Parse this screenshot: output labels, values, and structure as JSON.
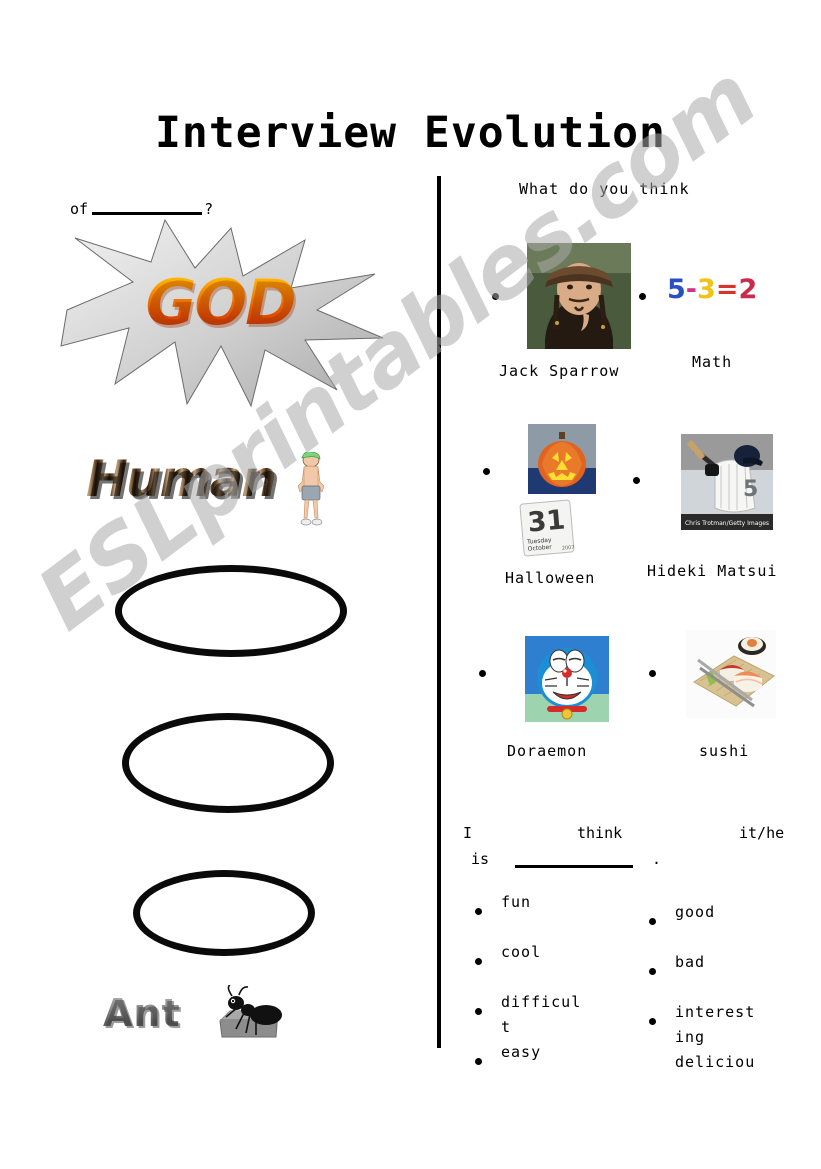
{
  "page": {
    "title": "Interview Evolution"
  },
  "left": {
    "of_prefix": "of",
    "of_suffix": "?",
    "god_word": "GOD",
    "human_word": "Human",
    "ant_word": "Ant",
    "human_figure_icon": "cartoon-muscle-man-icon",
    "ant_figure_icon": "ant-on-rock-icon",
    "starburst_icon": "starburst-shape-icon",
    "ovals": [
      {
        "name": "oval-1"
      },
      {
        "name": "oval-2"
      },
      {
        "name": "oval-3"
      }
    ]
  },
  "right": {
    "heading": "What do you think",
    "items": [
      {
        "label": "Jack Sparrow",
        "icon": "jack-sparrow-photo"
      },
      {
        "label": "Math",
        "icon": "math-equation-image"
      },
      {
        "label": "Halloween",
        "icon": "jack-o-lantern-photo"
      },
      {
        "label": "Hideki Matsui",
        "icon": "baseball-player-photo"
      },
      {
        "label": "Doraemon",
        "icon": "doraemon-cartoon-image"
      },
      {
        "label": "sushi",
        "icon": "sushi-platter-photo"
      }
    ],
    "math": {
      "five": "5",
      "minus": "-",
      "three": "3",
      "equals": "=",
      "two": "2"
    },
    "calendar": {
      "day_number": "31",
      "weekday": "Tuesday",
      "month": "October"
    },
    "baseball_photo_credit": "Chris Trotman/Getty Images",
    "sentence": {
      "word_i": "I",
      "word_think": "think",
      "word_it_he": "it/he",
      "word_is": "is",
      "period": "."
    },
    "adjectives_left": [
      "fun",
      "cool",
      "difficult",
      "easy"
    ],
    "adjectives_right": [
      "good",
      "bad",
      "interesting",
      "delicious"
    ]
  },
  "watermark": {
    "text": "ESLprintables.com"
  }
}
